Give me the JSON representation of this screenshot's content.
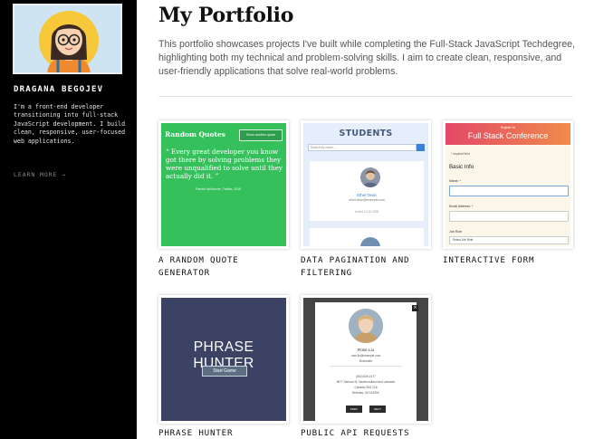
{
  "sidebar": {
    "name": "DRAGANA BEGOJEV",
    "bio": "I'm a front-end developer transitioning into full-stack JavaScript development. I build clean, responsive, user-focused web applications.",
    "learn_more": "LEARN MORE →"
  },
  "main": {
    "title": "My Portfolio",
    "intro": "This portfolio showcases projects I've built while completing the Full-Stack JavaScript Techdegree, highlighting both my technical and problem-solving skills. I aim to create clean, responsive, and user-friendly applications that solve real-world problems."
  },
  "projects": [
    {
      "label": "A RANDOM QUOTE GENERATOR",
      "thumb": {
        "title": "Random Quotes",
        "button": "Show another quote",
        "quote": "“ Every great developer you know got there by solving problems they were unqualified to solve until they actually did it. ”",
        "source": "Patrick McKenzie, Twitter, 2016"
      }
    },
    {
      "label": "DATA PAGINATION AND FILTERING",
      "thumb": {
        "title": "STUDENTS",
        "search_placeholder": "Search by name...",
        "student_name": "Ethel Dean",
        "student_email": "ethel.dean@example.com",
        "joined": "Joined 12-15-2005"
      }
    },
    {
      "label": "INTERACTIVE FORM",
      "thumb": {
        "register": "Register for",
        "title": "Full Stack Conference",
        "required": "* required field",
        "section": "Basic Info",
        "name_label": "Name: *",
        "email_label": "Email Address: *",
        "job_label": "Job Role",
        "job_value": "Select Job Role"
      }
    },
    {
      "label": "PHRASE HUNTER",
      "thumb": {
        "title": "PHRASE HUNTER",
        "button": "Start Game"
      }
    },
    {
      "label": "PUBLIC API REQUESTS",
      "thumb": {
        "name": "Rose Liu",
        "email": "rose.liu@example.com",
        "city": "Rochester",
        "phone": "(562) 826-1477",
        "address": "9877 Seneca St, Newfoundland and Labrador",
        "region": "Canada G6G 2L6",
        "birthday": "Birthday: 01/13/1994",
        "prev": "PREV",
        "next": "NEXT"
      }
    }
  ]
}
